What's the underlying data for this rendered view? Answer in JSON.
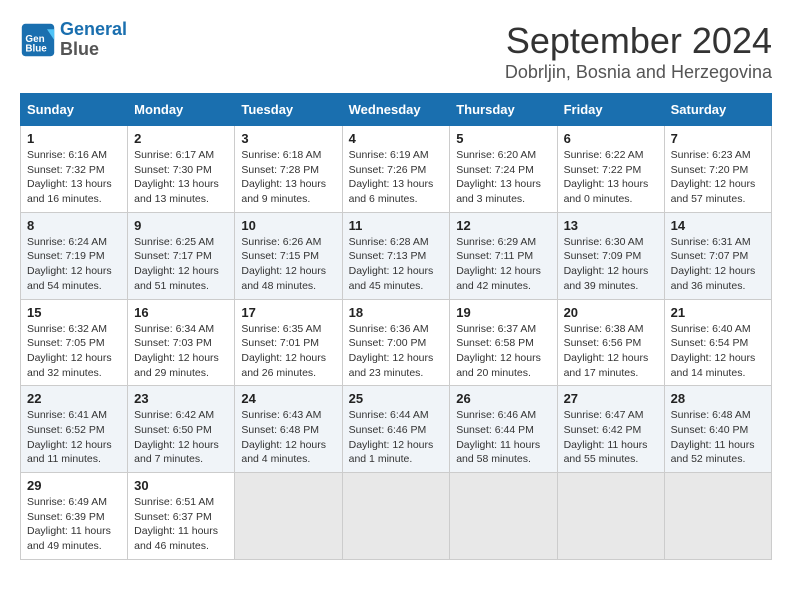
{
  "header": {
    "logo": {
      "line1": "General",
      "line2": "Blue"
    },
    "title": "September 2024",
    "subtitle": "Dobrljin, Bosnia and Herzegovina"
  },
  "calendar": {
    "days_of_week": [
      "Sunday",
      "Monday",
      "Tuesday",
      "Wednesday",
      "Thursday",
      "Friday",
      "Saturday"
    ],
    "weeks": [
      [
        {
          "day": "",
          "info": ""
        },
        {
          "day": "2",
          "info": "Sunrise: 6:17 AM\nSunset: 7:30 PM\nDaylight: 13 hours\nand 13 minutes."
        },
        {
          "day": "3",
          "info": "Sunrise: 6:18 AM\nSunset: 7:28 PM\nDaylight: 13 hours\nand 9 minutes."
        },
        {
          "day": "4",
          "info": "Sunrise: 6:19 AM\nSunset: 7:26 PM\nDaylight: 13 hours\nand 6 minutes."
        },
        {
          "day": "5",
          "info": "Sunrise: 6:20 AM\nSunset: 7:24 PM\nDaylight: 13 hours\nand 3 minutes."
        },
        {
          "day": "6",
          "info": "Sunrise: 6:22 AM\nSunset: 7:22 PM\nDaylight: 13 hours\nand 0 minutes."
        },
        {
          "day": "7",
          "info": "Sunrise: 6:23 AM\nSunset: 7:20 PM\nDaylight: 12 hours\nand 57 minutes."
        }
      ],
      [
        {
          "day": "8",
          "info": "Sunrise: 6:24 AM\nSunset: 7:19 PM\nDaylight: 12 hours\nand 54 minutes."
        },
        {
          "day": "9",
          "info": "Sunrise: 6:25 AM\nSunset: 7:17 PM\nDaylight: 12 hours\nand 51 minutes."
        },
        {
          "day": "10",
          "info": "Sunrise: 6:26 AM\nSunset: 7:15 PM\nDaylight: 12 hours\nand 48 minutes."
        },
        {
          "day": "11",
          "info": "Sunrise: 6:28 AM\nSunset: 7:13 PM\nDaylight: 12 hours\nand 45 minutes."
        },
        {
          "day": "12",
          "info": "Sunrise: 6:29 AM\nSunset: 7:11 PM\nDaylight: 12 hours\nand 42 minutes."
        },
        {
          "day": "13",
          "info": "Sunrise: 6:30 AM\nSunset: 7:09 PM\nDaylight: 12 hours\nand 39 minutes."
        },
        {
          "day": "14",
          "info": "Sunrise: 6:31 AM\nSunset: 7:07 PM\nDaylight: 12 hours\nand 36 minutes."
        }
      ],
      [
        {
          "day": "15",
          "info": "Sunrise: 6:32 AM\nSunset: 7:05 PM\nDaylight: 12 hours\nand 32 minutes."
        },
        {
          "day": "16",
          "info": "Sunrise: 6:34 AM\nSunset: 7:03 PM\nDaylight: 12 hours\nand 29 minutes."
        },
        {
          "day": "17",
          "info": "Sunrise: 6:35 AM\nSunset: 7:01 PM\nDaylight: 12 hours\nand 26 minutes."
        },
        {
          "day": "18",
          "info": "Sunrise: 6:36 AM\nSunset: 7:00 PM\nDaylight: 12 hours\nand 23 minutes."
        },
        {
          "day": "19",
          "info": "Sunrise: 6:37 AM\nSunset: 6:58 PM\nDaylight: 12 hours\nand 20 minutes."
        },
        {
          "day": "20",
          "info": "Sunrise: 6:38 AM\nSunset: 6:56 PM\nDaylight: 12 hours\nand 17 minutes."
        },
        {
          "day": "21",
          "info": "Sunrise: 6:40 AM\nSunset: 6:54 PM\nDaylight: 12 hours\nand 14 minutes."
        }
      ],
      [
        {
          "day": "22",
          "info": "Sunrise: 6:41 AM\nSunset: 6:52 PM\nDaylight: 12 hours\nand 11 minutes."
        },
        {
          "day": "23",
          "info": "Sunrise: 6:42 AM\nSunset: 6:50 PM\nDaylight: 12 hours\nand 7 minutes."
        },
        {
          "day": "24",
          "info": "Sunrise: 6:43 AM\nSunset: 6:48 PM\nDaylight: 12 hours\nand 4 minutes."
        },
        {
          "day": "25",
          "info": "Sunrise: 6:44 AM\nSunset: 6:46 PM\nDaylight: 12 hours\nand 1 minute."
        },
        {
          "day": "26",
          "info": "Sunrise: 6:46 AM\nSunset: 6:44 PM\nDaylight: 11 hours\nand 58 minutes."
        },
        {
          "day": "27",
          "info": "Sunrise: 6:47 AM\nSunset: 6:42 PM\nDaylight: 11 hours\nand 55 minutes."
        },
        {
          "day": "28",
          "info": "Sunrise: 6:48 AM\nSunset: 6:40 PM\nDaylight: 11 hours\nand 52 minutes."
        }
      ],
      [
        {
          "day": "29",
          "info": "Sunrise: 6:49 AM\nSunset: 6:39 PM\nDaylight: 11 hours\nand 49 minutes."
        },
        {
          "day": "30",
          "info": "Sunrise: 6:51 AM\nSunset: 6:37 PM\nDaylight: 11 hours\nand 46 minutes."
        },
        {
          "day": "",
          "info": ""
        },
        {
          "day": "",
          "info": ""
        },
        {
          "day": "",
          "info": ""
        },
        {
          "day": "",
          "info": ""
        },
        {
          "day": "",
          "info": ""
        }
      ]
    ],
    "first_day": {
      "day": "1",
      "info": "Sunrise: 6:16 AM\nSunset: 7:32 PM\nDaylight: 13 hours\nand 16 minutes."
    }
  }
}
